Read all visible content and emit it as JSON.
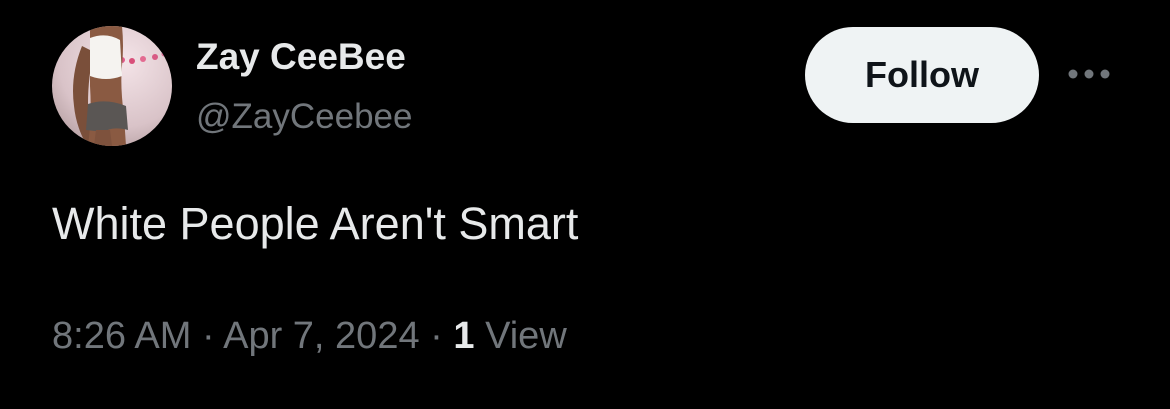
{
  "author": {
    "display_name": "Zay CeeBee",
    "handle": "@ZayCeebee"
  },
  "actions": {
    "follow_label": "Follow",
    "more_icon": "more-horizontal-icon"
  },
  "tweet": {
    "text": "White People Aren't Smart"
  },
  "meta": {
    "time": "8:26 AM",
    "separator": "·",
    "date": "Apr 7, 2024",
    "views_count": "1",
    "views_label": "View"
  },
  "colors": {
    "background": "#000000",
    "primary_text": "#e7e9ea",
    "secondary_text": "#71767b",
    "follow_button_bg": "#eff3f4",
    "follow_button_text": "#0f1419"
  }
}
